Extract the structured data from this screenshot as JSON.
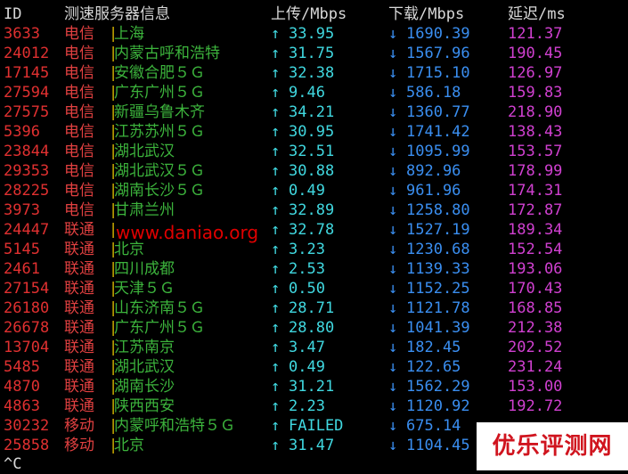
{
  "header": {
    "id": "ID",
    "server_info": "测速服务器信息",
    "upload": "上传/Mbps",
    "download": "下载/Mbps",
    "latency": "延迟/ms"
  },
  "separator": "|",
  "up_arrow": "↑",
  "down_arrow": "↓",
  "rows": [
    {
      "id": "3633",
      "isp": "电信",
      "city": "上海",
      "up": "33.95",
      "down": "1690.39",
      "latency": "121.37"
    },
    {
      "id": "24012",
      "isp": "电信",
      "city": "内蒙古呼和浩特",
      "up": "31.75",
      "down": "1567.96",
      "latency": "190.45"
    },
    {
      "id": "17145",
      "isp": "电信",
      "city": "安徽合肥５Ｇ",
      "up": "32.38",
      "down": "1715.10",
      "latency": "126.97"
    },
    {
      "id": "27594",
      "isp": "电信",
      "city": "广东广州５Ｇ",
      "up": "9.46",
      "down": "586.18",
      "latency": "159.83"
    },
    {
      "id": "27575",
      "isp": "电信",
      "city": "新疆乌鲁木齐",
      "up": "34.21",
      "down": "1360.77",
      "latency": "218.90"
    },
    {
      "id": "5396",
      "isp": "电信",
      "city": "江苏苏州５Ｇ",
      "up": "30.95",
      "down": "1741.42",
      "latency": "138.43"
    },
    {
      "id": "23844",
      "isp": "电信",
      "city": "湖北武汉",
      "up": "32.51",
      "down": "1095.99",
      "latency": "153.57"
    },
    {
      "id": "29353",
      "isp": "电信",
      "city": "湖北武汉５Ｇ",
      "up": "30.88",
      "down": "892.96",
      "latency": "178.99"
    },
    {
      "id": "28225",
      "isp": "电信",
      "city": "湖南长沙５Ｇ",
      "up": "0.49",
      "down": "961.96",
      "latency": "174.31"
    },
    {
      "id": "3973",
      "isp": "电信",
      "city": "甘肃兰州",
      "up": "32.89",
      "down": "1258.80",
      "latency": "172.87"
    },
    {
      "id": "24447",
      "isp": "联通",
      "city": "",
      "up": "32.78",
      "down": "1527.19",
      "latency": "189.34"
    },
    {
      "id": "5145",
      "isp": "联通",
      "city": "北京",
      "up": "3.23",
      "down": "1230.68",
      "latency": "152.54"
    },
    {
      "id": "2461",
      "isp": "联通",
      "city": "四川成都",
      "up": "2.53",
      "down": "1139.33",
      "latency": "193.06"
    },
    {
      "id": "27154",
      "isp": "联通",
      "city": "天津５Ｇ",
      "up": "0.50",
      "down": "1152.25",
      "latency": "170.43"
    },
    {
      "id": "26180",
      "isp": "联通",
      "city": "山东济南５Ｇ",
      "up": "28.71",
      "down": "1121.78",
      "latency": "168.85"
    },
    {
      "id": "26678",
      "isp": "联通",
      "city": "广东广州５Ｇ",
      "up": "28.80",
      "down": "1041.39",
      "latency": "212.38"
    },
    {
      "id": "13704",
      "isp": "联通",
      "city": "江苏南京",
      "up": "3.47",
      "down": "182.45",
      "latency": "202.52"
    },
    {
      "id": "5485",
      "isp": "联通",
      "city": "湖北武汉",
      "up": "0.49",
      "down": "122.65",
      "latency": "231.24"
    },
    {
      "id": "4870",
      "isp": "联通",
      "city": "湖南长沙",
      "up": "31.21",
      "down": "1562.29",
      "latency": "153.00"
    },
    {
      "id": "4863",
      "isp": "联通",
      "city": "陕西西安",
      "up": "2.23",
      "down": "1120.92",
      "latency": "192.72"
    },
    {
      "id": "30232",
      "isp": "移动",
      "city": "内蒙呼和浩特５Ｇ",
      "up": "FAILED",
      "down": "675.14",
      "latency": ""
    },
    {
      "id": "25858",
      "isp": "移动",
      "city": "北京",
      "up": "31.47",
      "down": "1104.45",
      "latency": ""
    }
  ],
  "prompt": "^C",
  "watermark_url": "www.daniao.org",
  "logo_text": "优乐评测网",
  "colors": {
    "background": "#000000",
    "id": "#e03030",
    "isp": "#e04040",
    "separator": "#d0b000",
    "city": "#3cb33c",
    "upload": "#40d8e0",
    "download": "#3a8ef0",
    "latency": "#d040d0",
    "watermark": "#e00000",
    "logo": "#d0141e"
  }
}
